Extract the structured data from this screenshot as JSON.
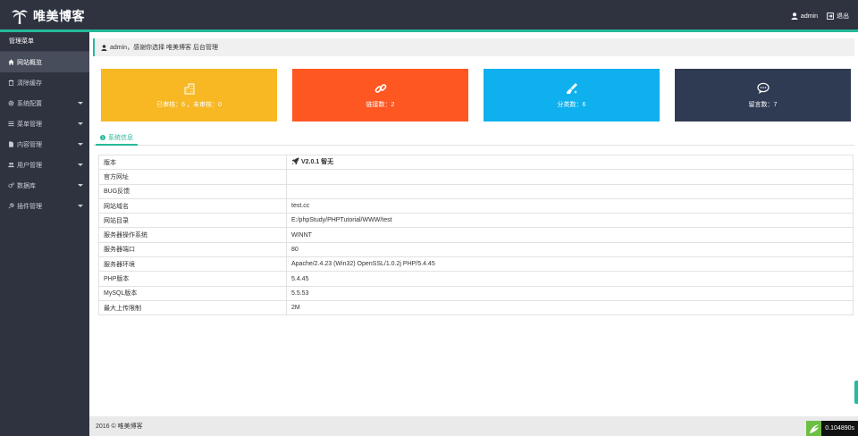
{
  "app": {
    "brand": "唯美博客",
    "user": "admin",
    "logout": "退出"
  },
  "sidebar": {
    "header": "管理菜单",
    "items": [
      {
        "label": "网站概览",
        "icon": "home-icon",
        "active": true,
        "caret": false
      },
      {
        "label": "清除缓存",
        "icon": "trash-icon",
        "active": false,
        "caret": false
      },
      {
        "label": "系统配置",
        "icon": "gear-icon",
        "active": false,
        "caret": true
      },
      {
        "label": "菜单管理",
        "icon": "list-icon",
        "active": false,
        "caret": true
      },
      {
        "label": "内容管理",
        "icon": "file-icon",
        "active": false,
        "caret": true
      },
      {
        "label": "用户管理",
        "icon": "users-icon",
        "active": false,
        "caret": true
      },
      {
        "label": "数据库",
        "icon": "gears-icon",
        "active": false,
        "caret": true
      },
      {
        "label": "插件管理",
        "icon": "plug-icon",
        "active": false,
        "caret": true
      }
    ]
  },
  "welcome": {
    "text": "admin，感谢你选择 唯美博客 后台管理"
  },
  "cards": [
    {
      "text": "已审核：6 ，未审核：0",
      "icon": "building-icon",
      "color": "#f7b824"
    },
    {
      "text": "链接数：2",
      "icon": "link-icon",
      "color": "#fe5722"
    },
    {
      "text": "分类数：6",
      "icon": "brush-icon",
      "color": "#0eb0ed"
    },
    {
      "text": "留言数：7",
      "icon": "chat-icon",
      "color": "#2f3b52"
    }
  ],
  "tab": {
    "label": "系统信息"
  },
  "system_info": {
    "version": "V2.0.1 智无",
    "rows": [
      {
        "key": "版本",
        "value": ""
      },
      {
        "key": "官方网址",
        "value": ""
      },
      {
        "key": "BUG反馈",
        "value": ""
      },
      {
        "key": "网站域名",
        "value": "test.cc"
      },
      {
        "key": "网站目录",
        "value": "E:/phpStudy/PHPTutorial/WWW/test"
      },
      {
        "key": "服务器操作系统",
        "value": "WINNT"
      },
      {
        "key": "服务器端口",
        "value": "80"
      },
      {
        "key": "服务器环境",
        "value": "Apache/2.4.23 (Win32) OpenSSL/1.0.2j PHP/5.4.45"
      },
      {
        "key": "PHP版本",
        "value": "5.4.45"
      },
      {
        "key": "MySQL版本",
        "value": "5.5.53"
      },
      {
        "key": "最大上传限制",
        "value": "2M"
      }
    ]
  },
  "footer": {
    "copyright": "2016 © 唯美博客",
    "exec_time": "0.104890s"
  },
  "colors": {
    "accent": "#26b99a",
    "sidebar_bg": "#2f3340"
  }
}
